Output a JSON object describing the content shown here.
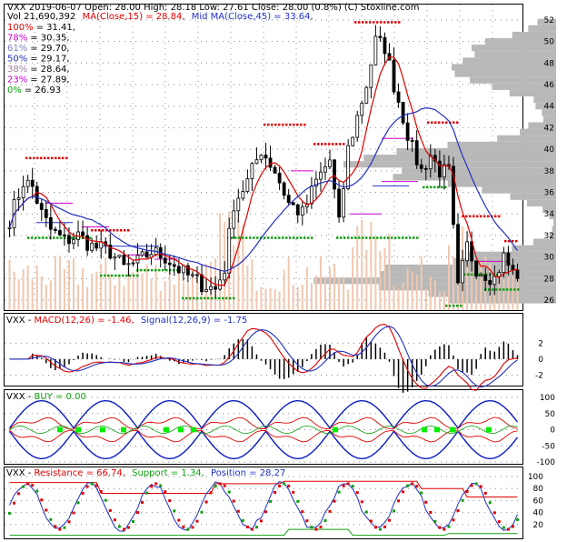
{
  "header": {
    "line1": "VXX  2019-06-07  Open: 28.00  High: 28.18  Low: 27.61  Close: 28.00 (0.8%)  (C) Stoxline.com",
    "vol": "Vol 21,690,392",
    "ma15": "MA(Close,15) = 28.84,",
    "ma45": "Mid MA(Close,45) = 33.64,",
    "fib": [
      {
        "pct": "100%",
        "val": "= 31.41,"
      },
      {
        "pct": "78%",
        "val": "= 30.35,"
      },
      {
        "pct": "61%",
        "val": "= 29.70,"
      },
      {
        "pct": "50%",
        "val": "= 29.17,"
      },
      {
        "pct": "38%",
        "val": "= 28.64,"
      },
      {
        "pct": "23%",
        "val": "= 27.89,"
      },
      {
        "pct": "0%",
        "val": "= 26.93"
      }
    ]
  },
  "macd_header": {
    "prefix": "VXX - ",
    "macd": "MACD(12,26) = -1.46,",
    "signal": "Signal(12,26,9) = -1.75"
  },
  "buy_header": {
    "prefix": "VXX - ",
    "buy": "BUY = 0.00"
  },
  "res_header": {
    "prefix": "VXX - ",
    "resistance": "Resistance = 66.74,",
    "support": "Support = 1.34,",
    "position": "Position = 28.27"
  },
  "colors": {
    "up": "#000000",
    "ma15": "#e00000",
    "ma45": "#2030c0",
    "volume": "#f0c8b0",
    "profile": "#b8b8b8",
    "resistance_marks": "#e00000",
    "support_marks": "#10a010",
    "mid_marks": "#cc00cc",
    "buy_marker": "#00ee00",
    "fib100": "#e00000",
    "fib78": "#cc00cc",
    "fib61": "#8080c0",
    "fib50": "#2030c0",
    "fib38": "#a080a0",
    "fib23": "#cc00cc",
    "fib0": "#10a010"
  },
  "chart_data": [
    {
      "type": "candlestick",
      "ylim": [
        25.5,
        53
      ],
      "yticks": [
        26,
        28,
        30,
        32,
        34,
        36,
        38,
        40,
        42,
        44,
        46,
        48,
        50,
        52
      ],
      "series": [
        {
          "name": "MA(Close,15)"
        },
        {
          "name": "Mid MA(Close,45)"
        }
      ],
      "fib_levels": [
        31.41,
        30.35,
        29.7,
        29.17,
        28.64,
        27.89,
        26.93
      ],
      "last": {
        "open": 28.0,
        "high": 28.18,
        "low": 27.61,
        "close": 28.0
      }
    },
    {
      "type": "line",
      "ylim": [
        -3.2,
        4.2
      ],
      "yticks": [
        -2,
        0,
        2
      ],
      "series": [
        {
          "name": "MACD(12,26)",
          "last": -1.46
        },
        {
          "name": "Signal(12,26,9)",
          "last": -1.75
        }
      ]
    },
    {
      "type": "line",
      "ylim": [
        -100,
        100
      ],
      "yticks": [
        -100,
        -50,
        0,
        50,
        100
      ],
      "series": [
        {
          "name": "BUY",
          "last": 0.0
        }
      ]
    },
    {
      "type": "line",
      "ylim": [
        0,
        100
      ],
      "yticks": [
        20,
        40,
        60,
        80,
        100
      ],
      "series": [
        {
          "name": "Resistance",
          "last": 66.74
        },
        {
          "name": "Support",
          "last": 1.34
        },
        {
          "name": "Position",
          "last": 28.27
        }
      ]
    }
  ]
}
